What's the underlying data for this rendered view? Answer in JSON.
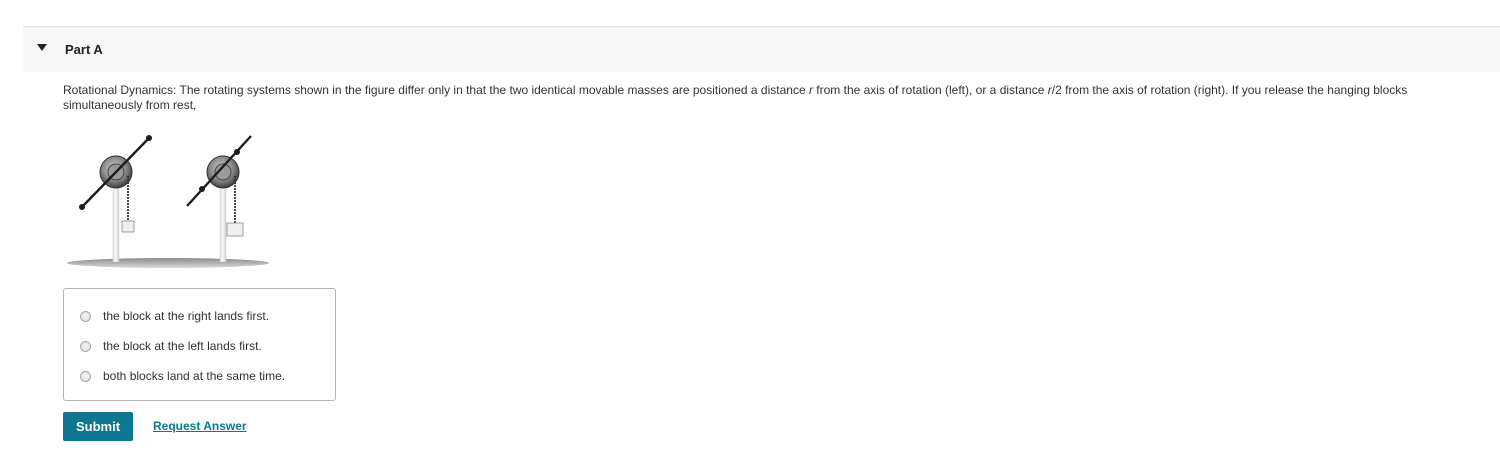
{
  "part": {
    "title": "Part A"
  },
  "question": {
    "prefix": "Rotational Dynamics: The rotating systems shown in the figure differ only in that the two identical movable masses are positioned a distance ",
    "var_r": "r",
    "middle": " from the axis of rotation (left), or a distance ",
    "var_r2": "r",
    "suffix": "/2 from the axis of rotation (right). If you release the hanging blocks simultaneously from rest,"
  },
  "choices": [
    {
      "label": "the block at the right lands first."
    },
    {
      "label": "the block at the left lands first."
    },
    {
      "label": "both blocks land at the same time."
    }
  ],
  "actions": {
    "submit_label": "Submit",
    "request_label": "Request Answer"
  },
  "colors": {
    "accent": "#0f7691",
    "header_bg": "#f7f7f7"
  }
}
